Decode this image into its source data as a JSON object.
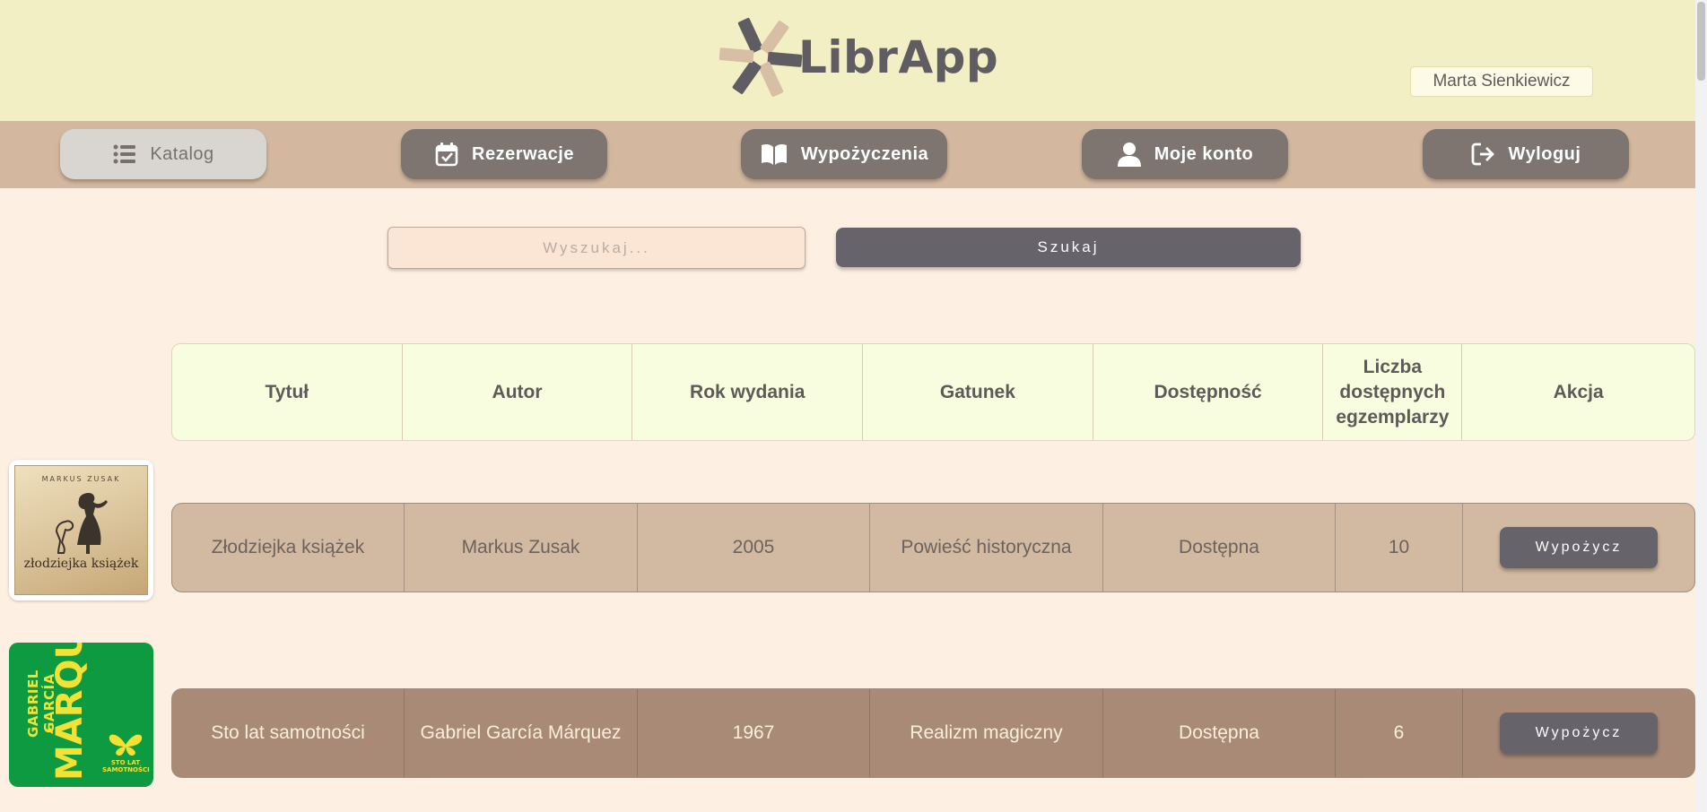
{
  "app": {
    "name": "LibrApp",
    "user_name": "Marta Sienkiewicz"
  },
  "nav": {
    "items": [
      {
        "label": "Katalog",
        "icon": "list-icon",
        "active": true
      },
      {
        "label": "Rezerwacje",
        "icon": "calendar-check-icon",
        "active": false
      },
      {
        "label": "Wypożyczenia",
        "icon": "open-book-icon",
        "active": false
      },
      {
        "label": "Moje konto",
        "icon": "user-icon",
        "active": false
      },
      {
        "label": "Wyloguj",
        "icon": "logout-icon",
        "active": false
      }
    ]
  },
  "search": {
    "placeholder": "Wyszukaj...",
    "value": "",
    "button_label": "Szukaj"
  },
  "table": {
    "headers": [
      "Tytuł",
      "Autor",
      "Rok wydania",
      "Gatunek",
      "Dostępność",
      "Liczba dostępnych egzemplarzy",
      "Akcja"
    ],
    "rows": [
      {
        "cover_author": "MARKUS ZUSAK",
        "cover_title": "złodziejka książek",
        "title": "Złodziejka książek",
        "author": "Markus Zusak",
        "year": "2005",
        "genre": "Powieść historyczna",
        "availability": "Dostępna",
        "copies": "10",
        "action": "Wypożycz"
      },
      {
        "cover_author": "GABRIEL GARCÍA",
        "cover_surname": "MÁRQUEZ",
        "cover_title": "STO LAT SAMOTNOŚCI",
        "title": "Sto lat samotności",
        "author": "Gabriel García Márquez",
        "year": "1967",
        "genre": "Realizm magiczny",
        "availability": "Dostępna",
        "copies": "6",
        "action": "Wypożycz"
      }
    ]
  },
  "colors": {
    "header_bg": "#f3efc5",
    "nav_bg": "#d3b89f",
    "page_bg": "#fdefe2",
    "button_dark": "#67636a",
    "row1_bg": "#d2b9a1",
    "row2_bg": "#a88a76"
  }
}
